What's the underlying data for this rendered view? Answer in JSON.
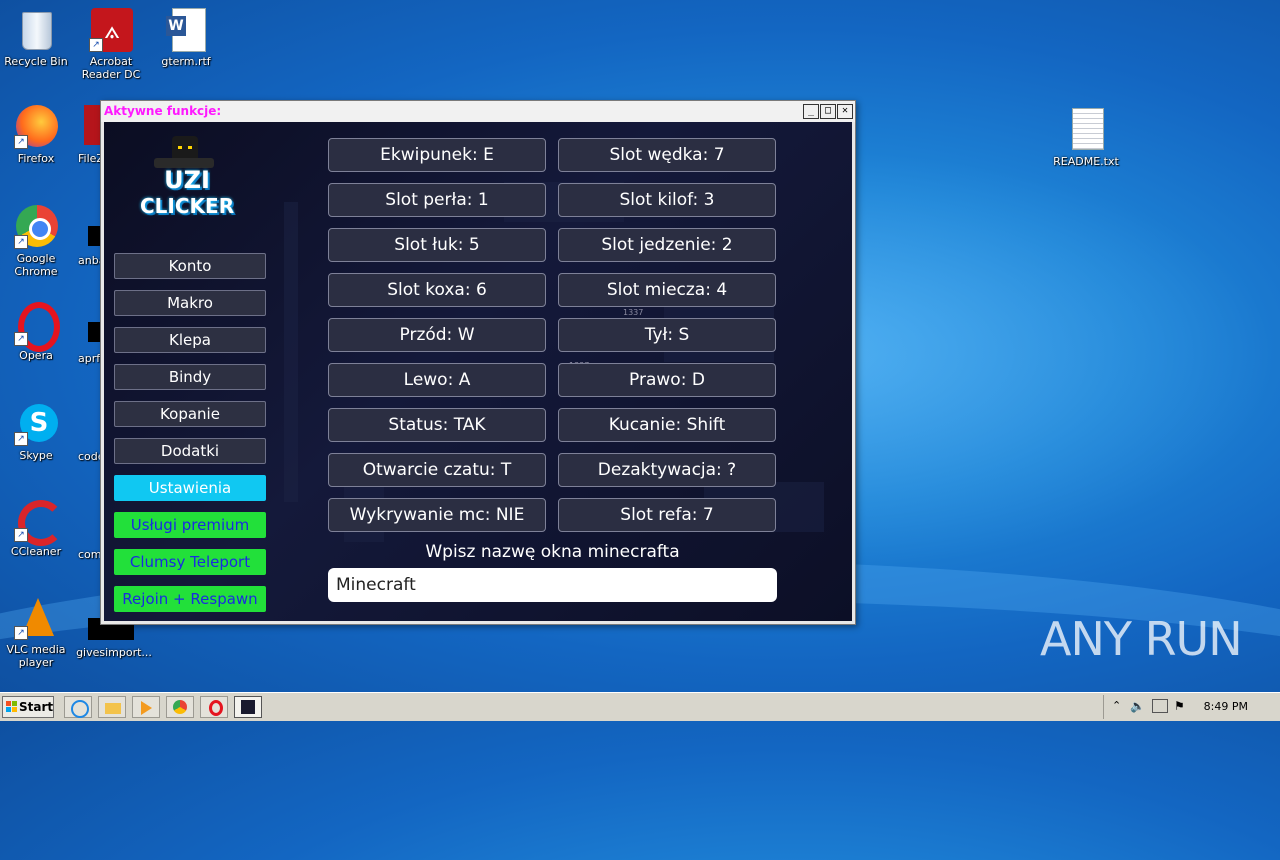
{
  "desktop": {
    "icons": [
      {
        "label": "Recycle Bin",
        "icon": "recycle-bin-icon"
      },
      {
        "label": "Acrobat Reader DC",
        "icon": "acrobat-icon"
      },
      {
        "label": "gterm.rtf",
        "icon": "word-document-icon"
      },
      {
        "label": "Firefox",
        "icon": "firefox-icon"
      },
      {
        "label": "FileZ",
        "icon": "filezilla-icon"
      },
      {
        "label": "Google Chrome",
        "icon": "chrome-icon"
      },
      {
        "label": "anba",
        "icon": "file-icon"
      },
      {
        "label": "Opera",
        "icon": "opera-icon"
      },
      {
        "label": "aprf",
        "icon": "file-icon"
      },
      {
        "label": "Skype",
        "icon": "skype-icon"
      },
      {
        "label": "code",
        "icon": "file-icon"
      },
      {
        "label": "CCleaner",
        "icon": "ccleaner-icon"
      },
      {
        "label": "comr",
        "icon": "file-icon"
      },
      {
        "label": "VLC media player",
        "icon": "vlc-icon"
      },
      {
        "label": "givesimport...",
        "icon": "file-icon"
      },
      {
        "label": "README.txt",
        "icon": "text-file-icon"
      }
    ]
  },
  "window": {
    "title": "Aktywne funkcje:",
    "buttons": {
      "minimize": "_",
      "maximize": "□",
      "close": "✕"
    },
    "watermark": "1337",
    "logo_text": [
      "UZI",
      "CLICKER"
    ],
    "nav": [
      {
        "label": "Konto"
      },
      {
        "label": "Makro"
      },
      {
        "label": "Klepa"
      },
      {
        "label": "Bindy"
      },
      {
        "label": "Kopanie"
      },
      {
        "label": "Dodatki"
      },
      {
        "label": "Ustawienia"
      },
      {
        "label": "Usługi premium"
      },
      {
        "label": "Clumsy Teleport"
      },
      {
        "label": "Rejoin + Respawn"
      }
    ],
    "settings": [
      {
        "label": "Ekwipunek: E"
      },
      {
        "label": "Slot wędka: 7"
      },
      {
        "label": "Slot perła: 1"
      },
      {
        "label": "Slot kilof: 3"
      },
      {
        "label": "Slot łuk: 5"
      },
      {
        "label": "Slot jedzenie: 2"
      },
      {
        "label": "Slot koxa: 6"
      },
      {
        "label": "Slot miecza: 4"
      },
      {
        "label": "Przód: W"
      },
      {
        "label": "Tył: S"
      },
      {
        "label": "Lewo: A"
      },
      {
        "label": "Prawo: D"
      },
      {
        "label": "Status: TAK"
      },
      {
        "label": "Kucanie: Shift"
      },
      {
        "label": "Otwarcie czatu: T"
      },
      {
        "label": "Dezaktywacja: ?"
      },
      {
        "label": "Wykrywanie mc: NIE"
      },
      {
        "label": "Slot refa: 7"
      }
    ],
    "window_name_label": "Wpisz nazwę okna minecrafta",
    "window_name_value": "Minecraft"
  },
  "taskbar": {
    "start_label": "Start",
    "apps": [
      "internet-explorer-icon",
      "file-explorer-icon",
      "media-player-icon",
      "chrome-icon",
      "opera-icon",
      "uzi-clicker-icon"
    ],
    "clock": "8:49 PM"
  },
  "watermark": "ANY RUN"
}
